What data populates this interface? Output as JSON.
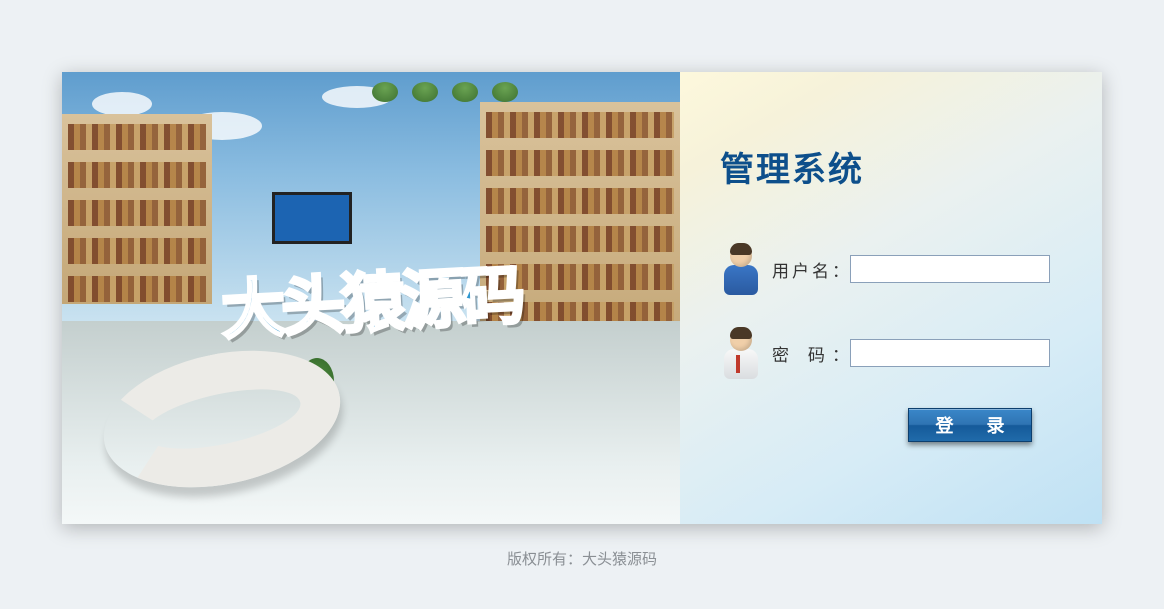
{
  "title": "管理系统",
  "watermark": "大头猿源码",
  "form": {
    "username_label": "用户名：",
    "username_value": "",
    "password_label": "密 码：",
    "password_value": ""
  },
  "login_button": "登 录",
  "footer_prefix": "版权所有：",
  "footer_owner": "大头猿源码"
}
